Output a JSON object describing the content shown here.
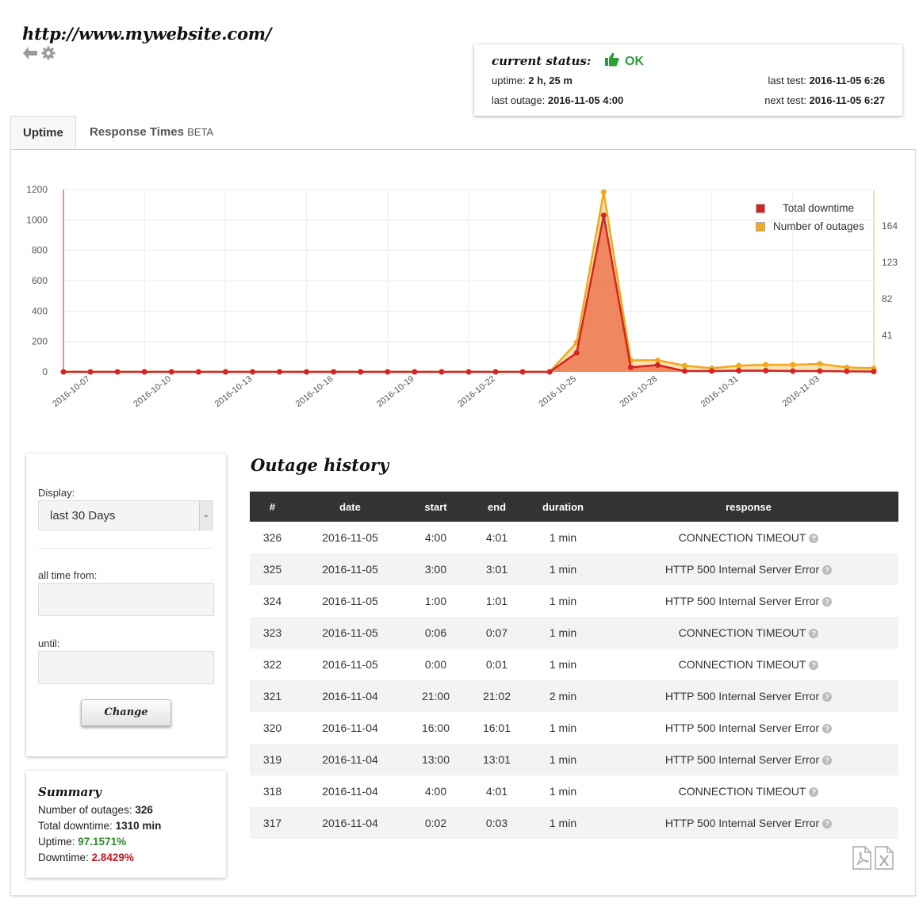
{
  "site": {
    "url": "http://www.mywebsite.com/"
  },
  "status": {
    "title": "current status:",
    "value": "OK",
    "uptime_label": "uptime:",
    "uptime_value": "2 h, 25 m",
    "last_outage_label": "last outage:",
    "last_outage_value": "2016-11-05 4:00",
    "last_test_label": "last test:",
    "last_test_value": "2016-11-05 6:26",
    "next_test_label": "next test:",
    "next_test_value": "2016-11-05 6:27"
  },
  "tabs": [
    {
      "label": "Uptime",
      "suffix": ""
    },
    {
      "label": "Response Times",
      "suffix": "BETA"
    }
  ],
  "chart_data": {
    "type": "line",
    "x": [
      "2016-10-06",
      "2016-10-07",
      "2016-10-08",
      "2016-10-09",
      "2016-10-10",
      "2016-10-11",
      "2016-10-12",
      "2016-10-13",
      "2016-10-14",
      "2016-10-15",
      "2016-10-16",
      "2016-10-17",
      "2016-10-18",
      "2016-10-19",
      "2016-10-20",
      "2016-10-21",
      "2016-10-22",
      "2016-10-23",
      "2016-10-24",
      "2016-10-25",
      "2016-10-26",
      "2016-10-27",
      "2016-10-28",
      "2016-10-29",
      "2016-10-30",
      "2016-10-31",
      "2016-11-01",
      "2016-11-02",
      "2016-11-03",
      "2016-11-04",
      "2016-11-05"
    ],
    "x_tick_labels": [
      "2016-10-07",
      "2016-10-10",
      "2016-10-13",
      "2016-10-16",
      "2016-10-19",
      "2016-10-22",
      "2016-10-25",
      "2016-10-28",
      "2016-10-31",
      "2016-11-03"
    ],
    "series": [
      {
        "name": "Total downtime",
        "axis": "left",
        "color": "#d42424",
        "values": [
          0,
          0,
          0,
          0,
          0,
          0,
          0,
          0,
          0,
          0,
          0,
          0,
          0,
          0,
          0,
          0,
          0,
          0,
          0,
          125,
          1030,
          30,
          45,
          5,
          5,
          8,
          8,
          5,
          5,
          3,
          2
        ]
      },
      {
        "name": "Number of outages",
        "axis": "right",
        "color": "#f0a81c",
        "values": [
          0,
          0,
          0,
          0,
          0,
          0,
          0,
          0,
          0,
          0,
          0,
          0,
          0,
          0,
          0,
          0,
          0,
          0,
          0,
          33,
          202,
          13,
          13,
          7,
          4,
          7,
          8,
          8,
          9,
          5,
          4
        ]
      }
    ],
    "left_axis": {
      "ticks": [
        0,
        200,
        400,
        600,
        800,
        1000,
        1200
      ],
      "ylim": [
        0,
        1200
      ]
    },
    "right_axis": {
      "ticks": [
        41,
        82,
        123,
        164
      ],
      "ylim": [
        0,
        205
      ]
    },
    "grid": true,
    "legend": "top-right"
  },
  "filter": {
    "display_label": "Display:",
    "display_value": "last 30 Days",
    "from_label": "all time from:",
    "until_label": "until:",
    "change_label": "Change"
  },
  "summary": {
    "title": "Summary",
    "outages_label": "Number of outages:",
    "outages_value": "326",
    "downtime_label": "Total downtime:",
    "downtime_value": "1310 min",
    "uptime_label": "Uptime:",
    "uptime_value": "97.1571%",
    "downtime_pct_label": "Downtime:",
    "downtime_pct_value": "2.8429%"
  },
  "history": {
    "title": "Outage history",
    "columns": [
      "#",
      "date",
      "start",
      "end",
      "duration",
      "response"
    ],
    "rows": [
      [
        "326",
        "2016-11-05",
        "4:00",
        "4:01",
        "1 min",
        "CONNECTION TIMEOUT"
      ],
      [
        "325",
        "2016-11-05",
        "3:00",
        "3:01",
        "1 min",
        "HTTP 500 Internal Server Error"
      ],
      [
        "324",
        "2016-11-05",
        "1:00",
        "1:01",
        "1 min",
        "HTTP 500 Internal Server Error"
      ],
      [
        "323",
        "2016-11-05",
        "0:06",
        "0:07",
        "1 min",
        "CONNECTION TIMEOUT"
      ],
      [
        "322",
        "2016-11-05",
        "0:00",
        "0:01",
        "1 min",
        "CONNECTION TIMEOUT"
      ],
      [
        "321",
        "2016-11-04",
        "21:00",
        "21:02",
        "2 min",
        "HTTP 500 Internal Server Error"
      ],
      [
        "320",
        "2016-11-04",
        "16:00",
        "16:01",
        "1 min",
        "HTTP 500 Internal Server Error"
      ],
      [
        "319",
        "2016-11-04",
        "13:00",
        "13:01",
        "1 min",
        "HTTP 500 Internal Server Error"
      ],
      [
        "318",
        "2016-11-04",
        "4:00",
        "4:01",
        "1 min",
        "CONNECTION TIMEOUT"
      ],
      [
        "317",
        "2016-11-04",
        "0:02",
        "0:03",
        "1 min",
        "HTTP 500 Internal Server Error"
      ]
    ]
  },
  "icons": {
    "back": "arrow-left-icon",
    "settings": "gear-icon",
    "ok": "thumbs-up-icon",
    "pdf": "pdf-file-icon",
    "excel": "excel-file-icon",
    "help": "question-circle-icon"
  }
}
